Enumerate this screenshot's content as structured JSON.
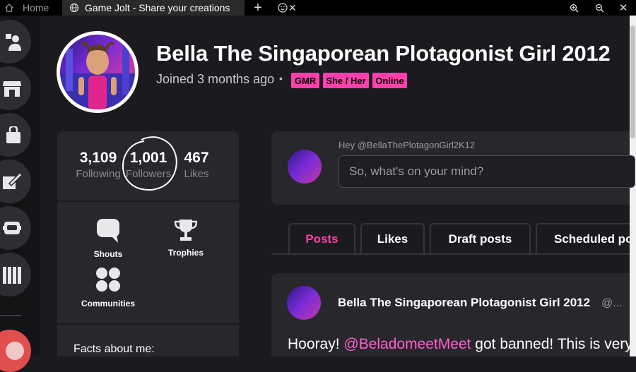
{
  "browser": {
    "home_label": "Home",
    "active_tab_title": "Game Jolt - Share your creations",
    "close_glyph": "✕",
    "new_tab_glyph": "+",
    "icons": [
      "home-icon",
      "globe-icon",
      "close-icon",
      "plus-icon",
      "emoji-icon",
      "zoom-in-icon",
      "zoom-out-icon",
      "window-close-icon"
    ]
  },
  "sidebar": {
    "items": [
      {
        "name": "activity",
        "icon": "person-icon"
      },
      {
        "name": "store",
        "icon": "store-icon"
      },
      {
        "name": "shop",
        "icon": "bag-icon"
      },
      {
        "name": "edit",
        "icon": "pen-icon"
      },
      {
        "name": "robot",
        "icon": "robot-icon"
      },
      {
        "name": "library",
        "icon": "library-icon"
      }
    ]
  },
  "profile": {
    "name": "Bella The Singaporean Plotagonist Girl 2012",
    "joined": "Joined 3 months ago",
    "separator": "•",
    "tags": [
      "GMR",
      "She / Her",
      "Online"
    ],
    "accent": "#ff3fac"
  },
  "stats": {
    "following": {
      "value": "3,109",
      "label": "Following"
    },
    "followers": {
      "value": "1,001",
      "label": "Followers"
    },
    "likes": {
      "value": "467",
      "label": "Likes"
    }
  },
  "links": {
    "shouts": "Shouts",
    "trophies": "Trophies",
    "communities": "Communities"
  },
  "facts_heading": "Facts about me:",
  "compose": {
    "greeting": "Hey @BellaThePlotagonGirl2K12",
    "placeholder": "So, what's on your mind?"
  },
  "tabs": [
    {
      "label": "Posts",
      "active": true
    },
    {
      "label": "Likes",
      "active": false
    },
    {
      "label": "Draft posts",
      "active": false
    },
    {
      "label": "Scheduled posts",
      "active": false
    }
  ],
  "post": {
    "author": "Bella The Singaporean Plotagonist Girl 2012",
    "handle": "@...",
    "text_before": "Hooray! ",
    "mention": "@BeladomeetMeet",
    "text_after": " got banned! This is very"
  }
}
